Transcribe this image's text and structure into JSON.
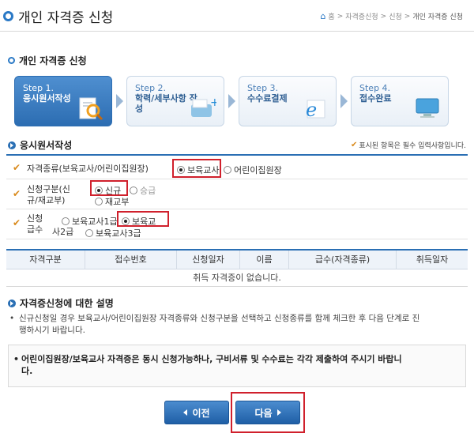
{
  "header": {
    "title": "개인 자격증 신청",
    "breadcrumb": [
      "홈",
      "자격증신청",
      "신청",
      "개인 자격증 신청"
    ]
  },
  "section_main": {
    "title": "개인 자격증 신청"
  },
  "steps": [
    {
      "num": "Step 1.",
      "name": "응시원서작성",
      "icon": "document-search-icon",
      "active": true
    },
    {
      "num": "Step 2.",
      "name": "학력/세부사항 작성",
      "icon": "edit-document-icon",
      "active": false
    },
    {
      "num": "Step 3.",
      "name": "수수료결제",
      "icon": "browser-e-icon",
      "active": false
    },
    {
      "num": "Step 4.",
      "name": "접수완료",
      "icon": "monitor-icon",
      "active": false
    }
  ],
  "form": {
    "title": "응시원서작성",
    "required_note": "표시된 항목은 필수 입력사항입니다.",
    "rows": [
      {
        "label": "자격종류(보육교사/어린이집원장)",
        "options": [
          "보육교사",
          "어린이집원장"
        ],
        "selected": "보육교사"
      },
      {
        "label": "신청구분(신규/재교부)",
        "label_line1": "신청구분(신",
        "label_line2": "규/재교부)",
        "options": [
          "신규",
          "승급",
          "재교부"
        ],
        "selected": "신규"
      },
      {
        "label": "신청급수",
        "label_line1": "신청",
        "label_line2": "급수",
        "options": [
          "보육교사1급",
          "보육교사2급",
          "보육교사3급"
        ],
        "selected": "보육교사2급",
        "option_text": [
          "보육교사1급",
          "보육교",
          "사2급",
          "보육교사3급"
        ]
      }
    ]
  },
  "table": {
    "columns": [
      "자격구분",
      "접수번호",
      "신청일자",
      "이름",
      "급수(자격종류)",
      "취득일자"
    ],
    "empty_message": "취득 자격증이 없습니다."
  },
  "description": {
    "title": "자격증신청에 대한 설명",
    "text": "신규신청일 경우 보육교사/어린이집원장 자격종류와 신청구분을 선택하고 신청종류를 함께 체크한 후 다음 단계로 진행하시기 바랍니다.",
    "line1": "신규신청일 경우 보육교사/어린이집원장 자격종류와 신청구분을 선택하고 신청종류를 함께 체크한 후 다음 단계로 진",
    "line2": "행하시기 바랍니다.",
    "notice": "어린이집원장/보육교사 자격증은 동시 신청가능하나, 구비서류 및 수수료는 각각 제출하여 주시기 바랍니다.",
    "notice_line1": "어린이집원장/보육교사 자격증은 동시 신청가능하나, 구비서류 및 수수료는 각각 제출하여 주시기 바랍니",
    "notice_line2": "다."
  },
  "buttons": {
    "prev": "이전",
    "next": "다음"
  }
}
